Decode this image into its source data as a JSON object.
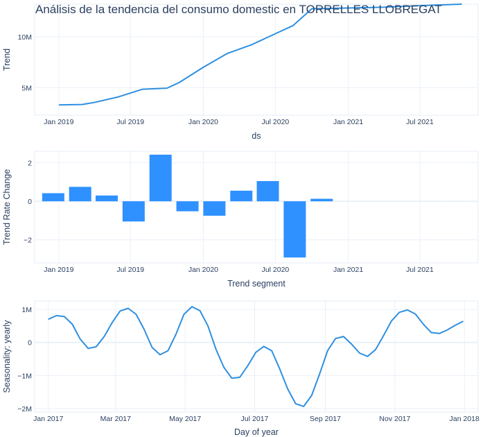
{
  "title": "Análisis de la tendencia del consumo domestic en TORRELLES LLOBREGAT",
  "colors": {
    "line": "#2e8fe0",
    "bar": "#2e91ff",
    "text": "#2a3f5f",
    "grid": "#ebf0f8"
  },
  "chart_data": [
    {
      "type": "line",
      "name": "trend",
      "xlabel": "ds",
      "ylabel": "Trend",
      "xlim": [
        "2018-11-01",
        "2021-11-25"
      ],
      "ylim": [
        2300000,
        13200000
      ],
      "xticks": [
        {
          "x": "2019-01-01",
          "label": "Jan 2019"
        },
        {
          "x": "2019-07-01",
          "label": "Jul 2019"
        },
        {
          "x": "2020-01-01",
          "label": "Jan 2020"
        },
        {
          "x": "2020-07-01",
          "label": "Jul 2020"
        },
        {
          "x": "2021-01-01",
          "label": "Jan 2021"
        },
        {
          "x": "2021-07-01",
          "label": "Jul 2021"
        }
      ],
      "yticks": [
        {
          "y": 5000000,
          "label": "5M"
        },
        {
          "y": 10000000,
          "label": "10M"
        }
      ],
      "x": [
        "2019-01-01",
        "2019-03-01",
        "2019-04-01",
        "2019-06-01",
        "2019-08-01",
        "2019-10-01",
        "2019-11-01",
        "2020-01-01",
        "2020-03-01",
        "2020-05-01",
        "2020-07-01",
        "2020-08-15",
        "2020-10-01",
        "2020-12-01",
        "2021-02-01",
        "2021-04-01",
        "2021-06-01",
        "2021-08-01",
        "2021-10-15"
      ],
      "y": [
        3300000,
        3350000,
        3550000,
        4100000,
        4850000,
        4950000,
        5500000,
        7000000,
        8350000,
        9200000,
        10300000,
        11100000,
        12750000,
        12800000,
        12850000,
        12900000,
        13000000,
        13100000,
        13200000
      ]
    },
    {
      "type": "bar",
      "name": "trend_rate_change",
      "xlabel": "Trend segment",
      "ylabel": "Trend Rate Change",
      "xlim": [
        "2018-11-01",
        "2021-11-25"
      ],
      "ylim": [
        -3.2,
        2.6
      ],
      "xticks": [
        {
          "x": "2019-01-01",
          "label": "Jan 2019"
        },
        {
          "x": "2019-07-01",
          "label": "Jul 2019"
        },
        {
          "x": "2020-01-01",
          "label": "Jan 2020"
        },
        {
          "x": "2020-07-01",
          "label": "Jul 2020"
        },
        {
          "x": "2021-01-01",
          "label": "Jan 2021"
        },
        {
          "x": "2021-07-01",
          "label": "Jul 2021"
        }
      ],
      "yticks": [
        {
          "y": 2,
          "label": "2"
        },
        {
          "y": 0,
          "label": "0"
        },
        {
          "y": -2,
          "label": "−2"
        }
      ],
      "x": [
        "2018-12-18",
        "2019-02-24",
        "2019-05-02",
        "2019-07-09",
        "2019-09-15",
        "2019-11-22",
        "2020-01-29",
        "2020-04-06",
        "2020-06-12",
        "2020-08-19",
        "2020-10-26",
        "2021-01-02",
        "2021-03-11",
        "2021-05-18",
        "2021-07-25",
        "2021-10-01"
      ],
      "values": [
        0.42,
        0.75,
        0.3,
        -1.05,
        2.42,
        -0.52,
        -0.75,
        0.55,
        1.05,
        -2.92,
        0.13,
        0.0,
        0.0,
        0.0,
        0.0,
        0.0
      ]
    },
    {
      "type": "line",
      "name": "seasonality_yearly",
      "xlabel": "Day of year",
      "ylabel": "Seasonality: yearly",
      "xlim": [
        "2016-12-20",
        "2018-01-13"
      ],
      "ylim": [
        -2100000,
        1250000
      ],
      "xticks": [
        {
          "x": "2017-01-01",
          "label": "Jan 2017"
        },
        {
          "x": "2017-03-01",
          "label": "Mar 2017"
        },
        {
          "x": "2017-05-01",
          "label": "May 2017"
        },
        {
          "x": "2017-07-01",
          "label": "Jul 2017"
        },
        {
          "x": "2017-09-01",
          "label": "Sep 2017"
        },
        {
          "x": "2017-11-01",
          "label": "Nov 2017"
        },
        {
          "x": "2018-01-01",
          "label": "Jan 2018"
        }
      ],
      "yticks": [
        {
          "y": 1000000,
          "label": "1M"
        },
        {
          "y": 0,
          "label": "0"
        },
        {
          "y": -1000000,
          "label": "−1M"
        },
        {
          "y": -2000000,
          "label": "−2M"
        }
      ],
      "x": [
        "2017-01-01",
        "2017-01-08",
        "2017-01-15",
        "2017-01-22",
        "2017-01-29",
        "2017-02-05",
        "2017-02-12",
        "2017-02-19",
        "2017-02-26",
        "2017-03-05",
        "2017-03-12",
        "2017-03-19",
        "2017-03-26",
        "2017-04-02",
        "2017-04-09",
        "2017-04-16",
        "2017-04-23",
        "2017-04-30",
        "2017-05-07",
        "2017-05-14",
        "2017-05-21",
        "2017-05-28",
        "2017-06-04",
        "2017-06-11",
        "2017-06-18",
        "2017-06-25",
        "2017-07-02",
        "2017-07-09",
        "2017-07-16",
        "2017-07-23",
        "2017-07-30",
        "2017-08-06",
        "2017-08-13",
        "2017-08-20",
        "2017-08-27",
        "2017-09-03",
        "2017-09-10",
        "2017-09-17",
        "2017-09-24",
        "2017-10-01",
        "2017-10-08",
        "2017-10-15",
        "2017-10-22",
        "2017-10-29",
        "2017-11-05",
        "2017-11-12",
        "2017-11-19",
        "2017-11-26",
        "2017-12-03",
        "2017-12-10",
        "2017-12-17",
        "2017-12-24",
        "2017-12-31"
      ],
      "y": [
        700000,
        810000,
        780000,
        550000,
        100000,
        -180000,
        -130000,
        180000,
        600000,
        950000,
        1030000,
        850000,
        400000,
        -150000,
        -370000,
        -250000,
        250000,
        850000,
        1080000,
        960000,
        500000,
        -200000,
        -750000,
        -1080000,
        -1050000,
        -700000,
        -300000,
        -120000,
        -250000,
        -800000,
        -1400000,
        -1850000,
        -1930000,
        -1600000,
        -950000,
        -250000,
        120000,
        180000,
        -50000,
        -320000,
        -420000,
        -220000,
        200000,
        650000,
        910000,
        980000,
        860000,
        550000,
        300000,
        270000,
        380000,
        520000,
        640000
      ]
    }
  ]
}
